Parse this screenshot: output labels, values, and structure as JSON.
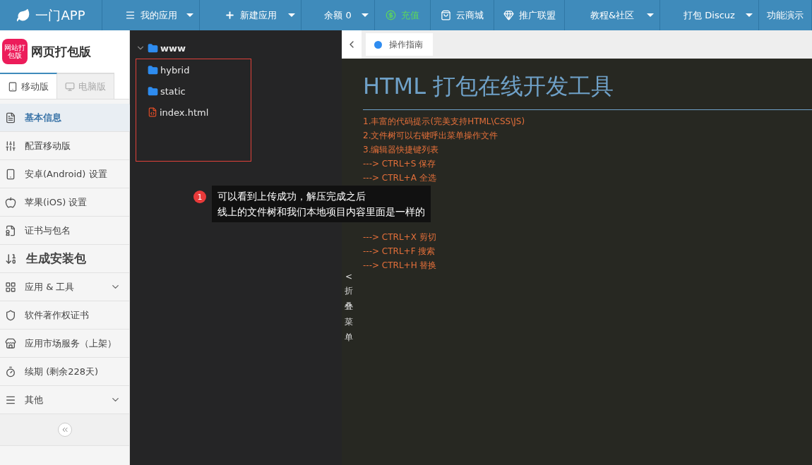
{
  "nav": [
    {
      "kind": "logo",
      "label": "一门APP",
      "dropdown": false
    },
    {
      "kind": "list",
      "label": "我的应用",
      "dropdown": true
    },
    {
      "kind": "add",
      "label": "新建应用",
      "dropdown": true
    },
    {
      "kind": "plain",
      "label": "余额 0",
      "dropdown": true
    },
    {
      "kind": "recharge",
      "label": "充值",
      "dropdown": false
    },
    {
      "kind": "store",
      "label": "云商城",
      "dropdown": false
    },
    {
      "kind": "promo",
      "label": "推广联盟",
      "dropdown": false
    },
    {
      "kind": "plain",
      "label": "教程&社区",
      "dropdown": true
    },
    {
      "kind": "plain",
      "label": "打包 Discuz",
      "dropdown": true
    },
    {
      "kind": "plain",
      "label": "功能演示",
      "dropdown": false
    }
  ],
  "sidebar": {
    "app_name": "网页打包版",
    "logo_text": "网站打包版",
    "tabs": [
      {
        "kind": "mobile",
        "label": "移动版",
        "selected": true
      },
      {
        "kind": "desktop",
        "label": "电脑版",
        "selected": false
      }
    ],
    "items": [
      {
        "kind": "info",
        "label": "基本信息",
        "selected": true
      },
      {
        "kind": "sliders",
        "label": "配置移动版",
        "selected": false
      },
      {
        "kind": "android",
        "label": "安卓(Android) 设置",
        "selected": false
      },
      {
        "kind": "apple",
        "label": "苹果(iOS) 设置",
        "selected": false
      },
      {
        "kind": "cert",
        "label": "证书与包名",
        "selected": false
      },
      {
        "kind": "build",
        "label": "生成安装包",
        "selected": false
      },
      {
        "kind": "tools",
        "label": "应用 & 工具",
        "selected": false,
        "expanded": false
      },
      {
        "kind": "copyright",
        "label": "软件著作权证书",
        "selected": false
      },
      {
        "kind": "market",
        "label": "应用市场服务（上架）",
        "selected": false
      },
      {
        "kind": "renew",
        "label": "续期 (剩余228天)",
        "selected": false
      },
      {
        "kind": "other",
        "label": "其他",
        "selected": false,
        "expanded": false
      }
    ]
  },
  "file_tree": [
    {
      "kind": "folder",
      "name": "www",
      "expanded": true,
      "children": [
        {
          "kind": "folder",
          "name": "hybrid"
        },
        {
          "kind": "folder",
          "name": "static"
        },
        {
          "kind": "html",
          "name": "index.html"
        }
      ]
    }
  ],
  "annotation": {
    "number": "1",
    "lines": [
      "可以看到上传成功，解压完成之后",
      "线上的文件树和我们本地项目内容里面是一样的"
    ]
  },
  "fold_menu": {
    "arrow": "<",
    "chars": [
      "折",
      "叠",
      "菜",
      "单"
    ]
  },
  "editor": {
    "tab": "操作指南",
    "title": "HTML 打包在线开发工具",
    "lines_top": [
      "1.丰富的代码提示(完美支持HTML\\CSS\\JS)",
      "2.文件树可以右键呼出菜单操作文件",
      "3.编辑器快捷键列表",
      "---> CTRL+S 保存",
      "---> CTRL+A 全选"
    ],
    "lines_bottom": [
      "---> CTRL+X 剪切",
      "---> CTRL+F 搜索",
      "---> CTRL+H 替换"
    ]
  }
}
